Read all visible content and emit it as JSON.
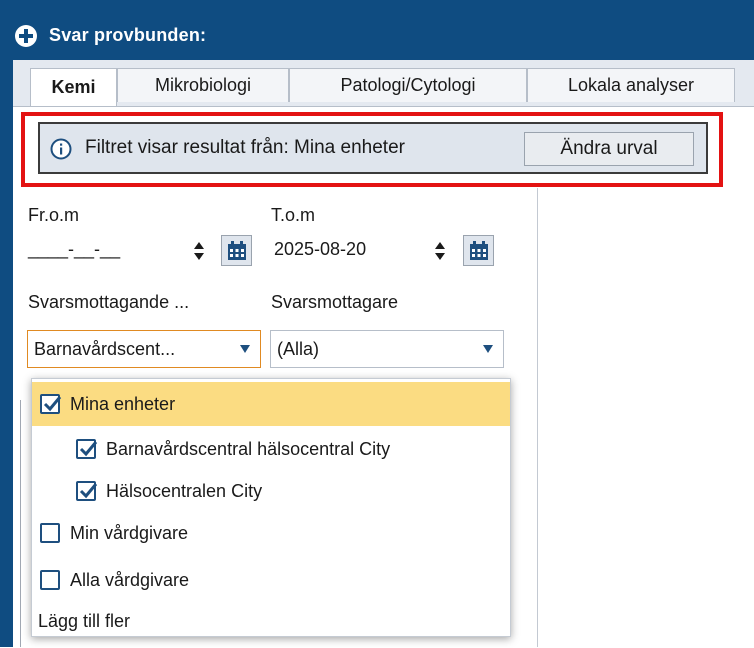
{
  "window": {
    "title": "Svar provbunden:"
  },
  "tabs": [
    {
      "label": "Kemi",
      "active": true
    },
    {
      "label": "Mikrobiologi",
      "active": false
    },
    {
      "label": "Patologi/Cytologi",
      "active": false
    },
    {
      "label": "Lokala analyser",
      "active": false
    }
  ],
  "banner": {
    "text": "Filtret visar resultat från: Mina enheter",
    "button_label": "Ändra urval",
    "icon": "info-icon"
  },
  "filters": {
    "from_label": "Fr.o.m",
    "from_value": "____-__-__",
    "to_label": "T.o.m",
    "to_value": "2025-08-20",
    "receiving_unit_label": "Svarsmottagande ...",
    "receiving_unit_value": "Barnavårdscent...",
    "receiver_label": "Svarsmottagare",
    "receiver_value": "(Alla)"
  },
  "dropdown": {
    "items": [
      {
        "label": "Mina enheter",
        "checked": true,
        "level": 0
      },
      {
        "label": "Barnavårdscentral hälsocentral City",
        "checked": true,
        "level": 1
      },
      {
        "label": "Hälsocentralen City",
        "checked": true,
        "level": 1
      },
      {
        "label": "Min vårdgivare",
        "checked": false,
        "level": 0
      },
      {
        "label": "Alla vårdgivare",
        "checked": false,
        "level": 0
      }
    ],
    "add_more": "Lägg till fler"
  },
  "colors": {
    "titlebar": "#0f4c81",
    "highlight": "#e31212",
    "selected_row": "#fbdc82",
    "checkbox": "#1e4f7f"
  }
}
